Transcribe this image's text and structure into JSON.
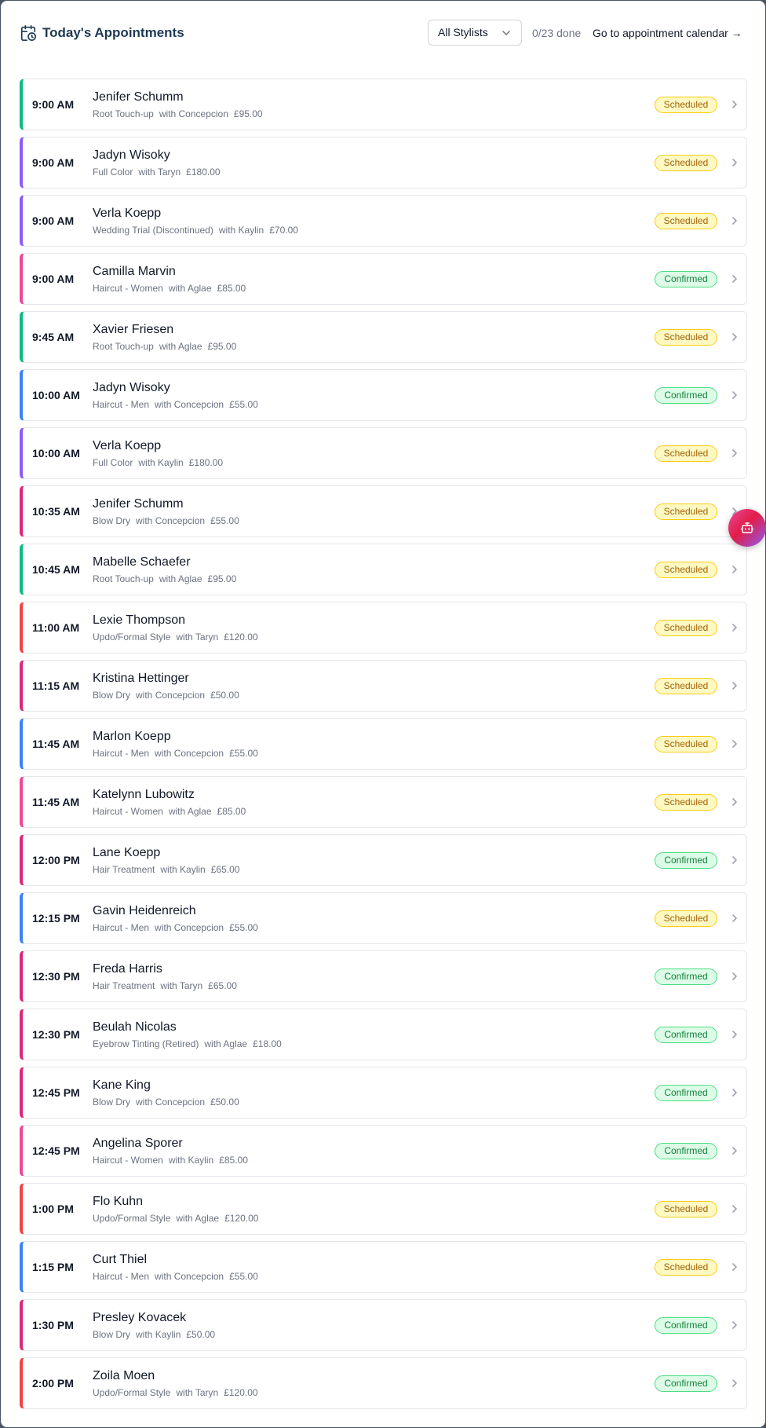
{
  "header": {
    "title": "Today's Appointments",
    "stylist_filter": "All Stylists",
    "done_count": "0/23 done",
    "calendar_link": "Go to appointment calendar →"
  },
  "colors": {
    "title": "#1f3a55",
    "scheduled": "#facc15",
    "confirmed": "#4ade80",
    "accent_green": "#10b981",
    "accent_purple": "#8b5cf6",
    "accent_pink": "#ec4899",
    "accent_blue": "#3b82f6",
    "accent_crimson": "#db2777",
    "accent_red": "#ef4444"
  },
  "appointments": [
    {
      "time": "9:00 AM",
      "client": "Jenifer Schumm",
      "service": "Root Touch-up",
      "stylist": "with Concepcion",
      "price": "£95.00",
      "status": "Scheduled",
      "accent": "#10b981"
    },
    {
      "time": "9:00 AM",
      "client": "Jadyn Wisoky",
      "service": "Full Color",
      "stylist": "with Taryn",
      "price": "£180.00",
      "status": "Scheduled",
      "accent": "#8b5cf6"
    },
    {
      "time": "9:00 AM",
      "client": "Verla Koepp",
      "service": "Wedding Trial (Discontinued)",
      "stylist": "with Kaylin",
      "price": "£70.00",
      "status": "Scheduled",
      "accent": "#8b5cf6"
    },
    {
      "time": "9:00 AM",
      "client": "Camilla Marvin",
      "service": "Haircut - Women",
      "stylist": "with Aglae",
      "price": "£85.00",
      "status": "Confirmed",
      "accent": "#ec4899"
    },
    {
      "time": "9:45 AM",
      "client": "Xavier Friesen",
      "service": "Root Touch-up",
      "stylist": "with Aglae",
      "price": "£95.00",
      "status": "Scheduled",
      "accent": "#10b981"
    },
    {
      "time": "10:00 AM",
      "client": "Jadyn Wisoky",
      "service": "Haircut - Men",
      "stylist": "with Concepcion",
      "price": "£55.00",
      "status": "Confirmed",
      "accent": "#3b82f6"
    },
    {
      "time": "10:00 AM",
      "client": "Verla Koepp",
      "service": "Full Color",
      "stylist": "with Kaylin",
      "price": "£180.00",
      "status": "Scheduled",
      "accent": "#8b5cf6"
    },
    {
      "time": "10:35 AM",
      "client": "Jenifer Schumm",
      "service": "Blow Dry",
      "stylist": "with Concepcion",
      "price": "£55.00",
      "status": "Scheduled",
      "accent": "#db2777"
    },
    {
      "time": "10:45 AM",
      "client": "Mabelle Schaefer",
      "service": "Root Touch-up",
      "stylist": "with Aglae",
      "price": "£95.00",
      "status": "Scheduled",
      "accent": "#10b981"
    },
    {
      "time": "11:00 AM",
      "client": "Lexie Thompson",
      "service": "Updo/Formal Style",
      "stylist": "with Taryn",
      "price": "£120.00",
      "status": "Scheduled",
      "accent": "#ef4444"
    },
    {
      "time": "11:15 AM",
      "client": "Kristina Hettinger",
      "service": "Blow Dry",
      "stylist": "with Concepcion",
      "price": "£50.00",
      "status": "Scheduled",
      "accent": "#db2777"
    },
    {
      "time": "11:45 AM",
      "client": "Marlon Koepp",
      "service": "Haircut - Men",
      "stylist": "with Concepcion",
      "price": "£55.00",
      "status": "Scheduled",
      "accent": "#3b82f6"
    },
    {
      "time": "11:45 AM",
      "client": "Katelynn Lubowitz",
      "service": "Haircut - Women",
      "stylist": "with Aglae",
      "price": "£85.00",
      "status": "Scheduled",
      "accent": "#ec4899"
    },
    {
      "time": "12:00 PM",
      "client": "Lane Koepp",
      "service": "Hair Treatment",
      "stylist": "with Kaylin",
      "price": "£65.00",
      "status": "Confirmed",
      "accent": "#db2777"
    },
    {
      "time": "12:15 PM",
      "client": "Gavin Heidenreich",
      "service": "Haircut - Men",
      "stylist": "with Concepcion",
      "price": "£55.00",
      "status": "Scheduled",
      "accent": "#3b82f6"
    },
    {
      "time": "12:30 PM",
      "client": "Freda Harris",
      "service": "Hair Treatment",
      "stylist": "with Taryn",
      "price": "£65.00",
      "status": "Confirmed",
      "accent": "#db2777"
    },
    {
      "time": "12:30 PM",
      "client": "Beulah Nicolas",
      "service": "Eyebrow Tinting (Retired)",
      "stylist": "with Aglae",
      "price": "£18.00",
      "status": "Confirmed",
      "accent": "#db2777"
    },
    {
      "time": "12:45 PM",
      "client": "Kane King",
      "service": "Blow Dry",
      "stylist": "with Concepcion",
      "price": "£50.00",
      "status": "Confirmed",
      "accent": "#db2777"
    },
    {
      "time": "12:45 PM",
      "client": "Angelina Sporer",
      "service": "Haircut - Women",
      "stylist": "with Kaylin",
      "price": "£85.00",
      "status": "Confirmed",
      "accent": "#ec4899"
    },
    {
      "time": "1:00 PM",
      "client": "Flo Kuhn",
      "service": "Updo/Formal Style",
      "stylist": "with Aglae",
      "price": "£120.00",
      "status": "Scheduled",
      "accent": "#ef4444"
    },
    {
      "time": "1:15 PM",
      "client": "Curt Thiel",
      "service": "Haircut - Men",
      "stylist": "with Concepcion",
      "price": "£55.00",
      "status": "Scheduled",
      "accent": "#3b82f6"
    },
    {
      "time": "1:30 PM",
      "client": "Presley Kovacek",
      "service": "Blow Dry",
      "stylist": "with Kaylin",
      "price": "£50.00",
      "status": "Confirmed",
      "accent": "#db2777"
    },
    {
      "time": "2:00 PM",
      "client": "Zoila Moen",
      "service": "Updo/Formal Style",
      "stylist": "with Taryn",
      "price": "£120.00",
      "status": "Confirmed",
      "accent": "#ef4444"
    }
  ]
}
